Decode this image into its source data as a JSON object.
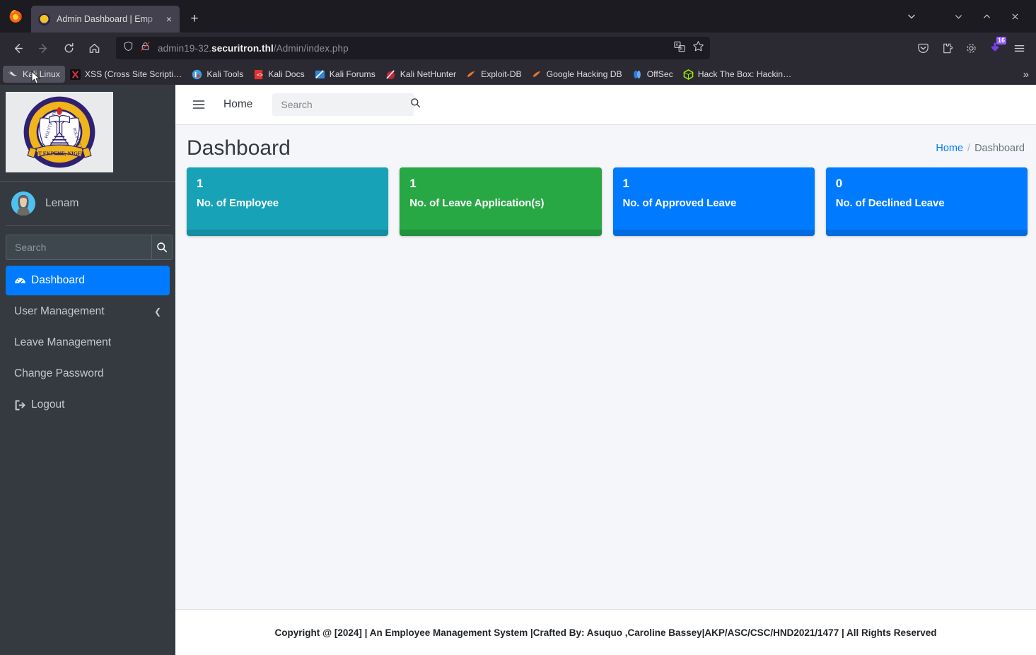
{
  "browser": {
    "tab": {
      "title": "Admin Dashboard | Emp",
      "favicon": "site-favicon",
      "close_label": "×"
    },
    "newtab_label": "+",
    "window_controls": {
      "list_all_tabs": "⌄",
      "minimize": "⌄",
      "maximize": "⌃",
      "close": "✕"
    },
    "nav": {
      "back": "←",
      "forward": "→",
      "reload": "↻",
      "home": "⌂"
    },
    "url": {
      "prefix": "admin19-32.",
      "host": "securitron.thl",
      "path": "/Admin/index.php",
      "full": "admin19-32.securitron.thl/Admin/index.php"
    },
    "url_actions": {
      "translate": "translate-icon",
      "bookmark": "star-icon"
    },
    "toolbar": {
      "pocket": "save-to-pocket",
      "extension": "extension-icon",
      "settings": "gear-icon",
      "downloads_badge": "16",
      "menu": "≡"
    },
    "bookmarks": [
      {
        "label": "Kali Linux",
        "icon": "kali-dragon-icon",
        "hovered": true
      },
      {
        "label": "XSS (Cross Site Scripti…",
        "icon": "xss-icon",
        "hovered": false
      },
      {
        "label": "Kali Tools",
        "icon": "kali-tools-icon",
        "hovered": false
      },
      {
        "label": "Kali Docs",
        "icon": "kali-docs-icon",
        "hovered": false
      },
      {
        "label": "Kali Forums",
        "icon": "kali-forums-icon",
        "hovered": false
      },
      {
        "label": "Kali NetHunter",
        "icon": "kali-nethunter-icon",
        "hovered": false
      },
      {
        "label": "Exploit-DB",
        "icon": "exploit-db-icon",
        "hovered": false
      },
      {
        "label": "Google Hacking DB",
        "icon": "google-hacking-db-icon",
        "hovered": false
      },
      {
        "label": "OffSec",
        "icon": "offsec-icon",
        "hovered": false
      },
      {
        "label": "Hack The Box: Hackin…",
        "icon": "hack-the-box-icon",
        "hovered": false
      }
    ],
    "bookmarks_overflow": "»"
  },
  "sidebar": {
    "brand_logo_alt": "Akwa Ibom State Polytechnic crest, Ikot Ekpene, Nigeria",
    "user": {
      "name": "Lenam",
      "avatar": "user-avatar"
    },
    "search": {
      "placeholder": "Search",
      "value": "",
      "button_icon": "search-icon"
    },
    "items": [
      {
        "label": "Dashboard",
        "icon": "dashboard-icon",
        "active": true,
        "arrow": ""
      },
      {
        "label": "User Management",
        "icon": "",
        "active": false,
        "arrow": "❮"
      },
      {
        "label": "Leave Management",
        "icon": "",
        "active": false,
        "arrow": ""
      },
      {
        "label": "Change Password",
        "icon": "",
        "active": false,
        "arrow": ""
      },
      {
        "label": "Logout",
        "icon": "logout-icon",
        "active": false,
        "arrow": ""
      }
    ]
  },
  "topnav": {
    "menu_toggle": "hamburger-icon",
    "home_label": "Home",
    "search": {
      "placeholder": "Search",
      "value": "",
      "icon": "search-icon"
    }
  },
  "main": {
    "title": "Dashboard",
    "breadcrumb": {
      "home": "Home",
      "separator": "/",
      "current": "Dashboard"
    },
    "cards": [
      {
        "value": "1",
        "label": "No. of Employee",
        "color": "#17a2b8"
      },
      {
        "value": "1",
        "label": "No. of Leave Application(s)",
        "color": "#28a745"
      },
      {
        "value": "1",
        "label": "No. of Approved Leave",
        "color": "#007bff"
      },
      {
        "value": "0",
        "label": "No. of Declined Leave",
        "color": "#007bff"
      }
    ]
  },
  "footer": {
    "text": "Copyright @ [2024] | An Employee Management System |Crafted By: Asuquo ,Caroline Bassey|AKP/ASC/CSC/HND2021/1477 | All Rights Reserved"
  }
}
